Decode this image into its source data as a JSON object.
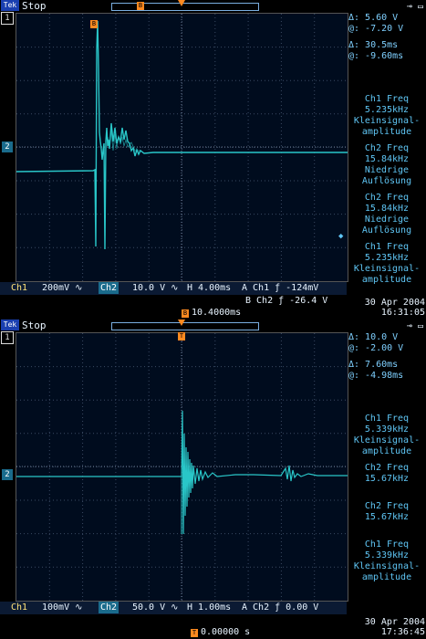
{
  "screen1": {
    "run_state": "Stop",
    "cursors": [
      "Δ: 5.60 V",
      "@: -7.20 V",
      "Δ: 30.5ms",
      "@: -9.60ms"
    ],
    "measurements": [
      {
        "label": "Ch1 Freq",
        "value": "5.235kHz",
        "note1": "Kleinsignal-",
        "note2": "amplitude"
      },
      {
        "label": "Ch2 Freq",
        "value": "15.84kHz",
        "note1": "Niedrige",
        "note2": "Auflösung"
      },
      {
        "label": "Ch2 Freq",
        "value": "15.84kHz",
        "note1": "Niedrige",
        "note2": "Auflösung"
      },
      {
        "label": "Ch1 Freq",
        "value": "5.235kHz",
        "note1": "Kleinsignal-",
        "note2": "amplitude"
      }
    ],
    "ch1_label": "Ch1",
    "ch1_scale": "200mV ∿",
    "ch2_label": "Ch2",
    "ch2_scale": "10.0 V ∿",
    "timebase": "H 4.00ms",
    "trigger_a": "A  Ch1  ƒ  -124mV",
    "trigger_b": "B  Ch2  ƒ  -26.4 V",
    "date": "30 Apr 2004",
    "time": "16:31:05",
    "trig_time": "10.4000ms",
    "marker_b": "B",
    "marker_2": "2",
    "marker_1": "1"
  },
  "screen2": {
    "run_state": "Stop",
    "cursors": [
      "Δ: 10.0 V",
      "@: -2.00 V",
      "Δ: 7.60ms",
      "@: -4.98ms"
    ],
    "measurements": [
      {
        "label": "Ch1 Freq",
        "value": "5.339kHz",
        "note1": "Kleinsignal-",
        "note2": "amplitude"
      },
      {
        "label": "Ch2 Freq",
        "value": "15.67kHz",
        "note1": "",
        "note2": ""
      },
      {
        "label": "Ch2 Freq",
        "value": "15.67kHz",
        "note1": "",
        "note2": ""
      },
      {
        "label": "Ch1 Freq",
        "value": "5.339kHz",
        "note1": "Kleinsignal-",
        "note2": "amplitude"
      }
    ],
    "ch1_label": "Ch1",
    "ch1_scale": "100mV ∿",
    "ch2_label": "Ch2",
    "ch2_scale": "50.0 V ∿",
    "timebase": "H 1.00ms",
    "trigger_a": "A  Ch2  ƒ  0.00 V",
    "date": "30 Apr 2004",
    "time": "17:36:45",
    "trig_time": "0.00000 s",
    "marker_t": "T",
    "marker_2": "2",
    "marker_1": "1"
  },
  "colors": {
    "trace": "#29c6c8",
    "grid": "#3a4a63",
    "marker": "#ff8a20",
    "accent": "#1a6b8c"
  }
}
